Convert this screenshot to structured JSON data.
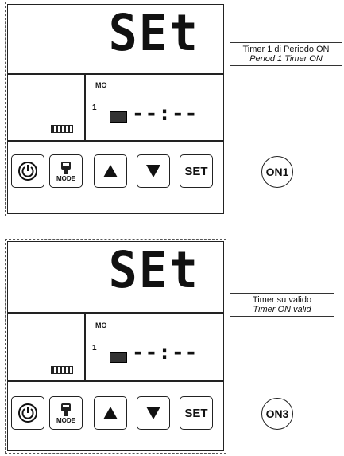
{
  "panels": [
    {
      "display_text": "SEt",
      "mode_label": "MO",
      "timer_number": "1",
      "timer_time": "--:--",
      "callout_line1": "Timer 1 di Periodo ON",
      "callout_line2": "Period 1 Timer ON",
      "badge": "ON1"
    },
    {
      "display_text": "SEt",
      "mode_label": "MO",
      "timer_number": "1",
      "timer_time": "--:--",
      "callout_line1": "Timer su valido",
      "callout_line2": "Timer ON valid",
      "badge": "ON3"
    }
  ],
  "buttons": {
    "power": "power-icon",
    "mode_label": "MODE",
    "up": "arrow-up-icon",
    "down": "arrow-down-icon",
    "set_label": "SET"
  }
}
